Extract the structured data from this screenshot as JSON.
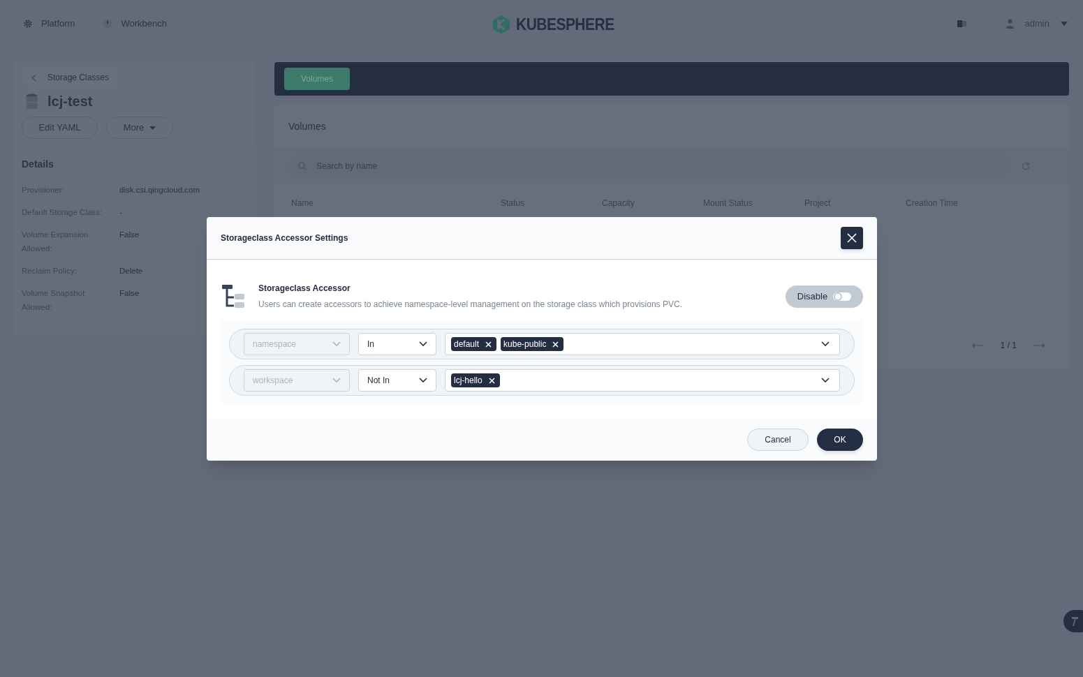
{
  "nav": {
    "items": [
      {
        "label": "Platform",
        "kind": "gear"
      },
      {
        "label": "Workbench",
        "kind": "dial"
      }
    ],
    "logo": "KUBESPHERE",
    "user": "admin"
  },
  "sidebar": {
    "back": "Storage Classes",
    "title": "lcj-test",
    "buttons": [
      {
        "label": "Edit YAML",
        "kind": "plain"
      },
      {
        "label": "More",
        "kind": "menu"
      }
    ],
    "details_title": "Details",
    "details": [
      {
        "label": "Provisioner:",
        "value": "disk.csi.qingcloud.com"
      },
      {
        "label": "Default Storage Class:",
        "value": "-"
      },
      {
        "label": "Volume Expansion Allowed:",
        "value": "False"
      },
      {
        "label": "Reclaim Policy:",
        "value": "Delete"
      },
      {
        "label": "Volume Snapshot Allowed:",
        "value": "False"
      }
    ]
  },
  "tabs": [
    {
      "label": "Volumes",
      "selected": true
    }
  ],
  "volumes": {
    "title": "Volumes",
    "search": {
      "placeholder": "Search by name"
    },
    "columns": [
      "Name",
      "Status",
      "Capacity",
      "Mount Status",
      "Project",
      "Creation Time"
    ],
    "pagination": "1 / 1"
  },
  "modal": {
    "title": "Storageclass Accessor Settings",
    "heading": "Storageclass Accessor",
    "description": "Users can create accessors to achieve namespace-level management on the storage class which provisions PVC.",
    "toggle": {
      "label": "Disable",
      "on": false
    },
    "rules": [
      {
        "key": "namespace",
        "operator": "In",
        "values": [
          "default",
          "kube-public"
        ]
      },
      {
        "key": "workspace",
        "operator": "Not In",
        "values": [
          "lcj-hello"
        ]
      }
    ],
    "buttons": [
      {
        "label": "Cancel",
        "kind": "secondary"
      },
      {
        "label": "OK",
        "kind": "primary"
      }
    ]
  }
}
